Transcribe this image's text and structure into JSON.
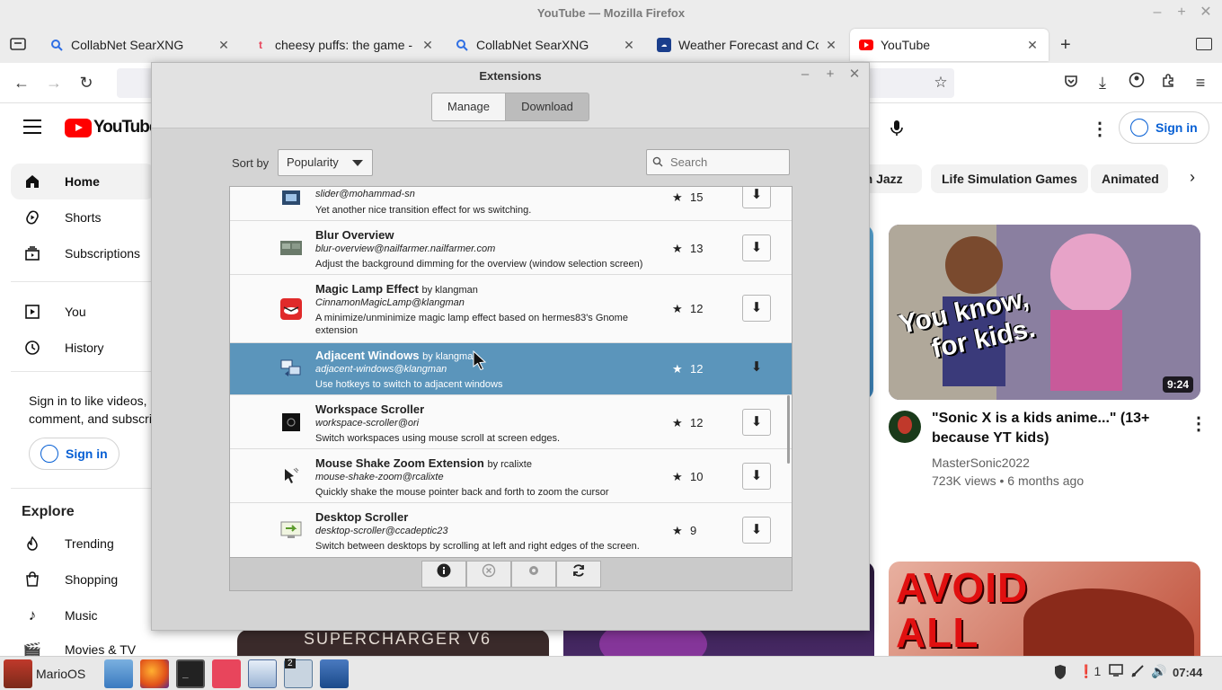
{
  "window": {
    "title": "YouTube — Mozilla Firefox"
  },
  "tabs": [
    {
      "label": "CollabNet SearXNG",
      "icon": "search-icon",
      "color": "#2f6fe4"
    },
    {
      "label": "cheesy puffs: the game - Tur",
      "icon": "tumblr-icon",
      "color": "#e8455c"
    },
    {
      "label": "CollabNet SearXNG",
      "icon": "search-icon",
      "color": "#2f6fe4"
    },
    {
      "label": "Weather Forecast and Condi",
      "icon": "weather-icon",
      "color": "#1a3e8c"
    },
    {
      "label": "YouTube",
      "icon": "youtube-icon",
      "color": "#ff0000",
      "active": true
    }
  ],
  "youtube": {
    "logo": "YouTube",
    "nav": [
      {
        "label": "Home",
        "icon": "home-icon"
      },
      {
        "label": "Shorts",
        "icon": "shorts-icon"
      },
      {
        "label": "Subscriptions",
        "icon": "subscriptions-icon"
      },
      {
        "label": "You",
        "icon": "you-icon"
      },
      {
        "label": "History",
        "icon": "history-icon"
      }
    ],
    "signin_prompt_line1": "Sign in to like videos,",
    "signin_prompt_line2": "comment, and subscribe.",
    "signin_label": "Sign in",
    "explore_title": "Explore",
    "explore": [
      {
        "label": "Trending",
        "icon": "trending-icon"
      },
      {
        "label": "Shopping",
        "icon": "shopping-icon"
      },
      {
        "label": "Music",
        "icon": "music-icon"
      },
      {
        "label": "Movies & TV",
        "icon": "movies-icon"
      }
    ],
    "chips": [
      "th Jazz",
      "Life Simulation Games",
      "Animated"
    ],
    "video": {
      "thumb_text_line1": "You know,",
      "thumb_text_line2": "for kids.",
      "duration": "9:24",
      "title": "\"Sonic X is a kids anime...\" (13+ because YT kids)",
      "channel": "MasterSonic2022",
      "stats": "723K views • 6 months ago"
    },
    "thumb2_text_line1": "AVOID",
    "thumb2_text_line2": "ALL",
    "thumb3_text": "SUPERCHARGER V6"
  },
  "extensions": {
    "title": "Extensions",
    "tabs": {
      "manage": "Manage",
      "download": "Download"
    },
    "sort_label": "Sort by",
    "sort_value": "Popularity",
    "search_placeholder": "Search",
    "items": [
      {
        "name": "",
        "by": "",
        "uuid": "slider@mohammad-sn",
        "desc": "Yet another nice transition effect for ws switching.",
        "score": "15",
        "icon": "slider-icon"
      },
      {
        "name": "Blur Overview",
        "by": "",
        "uuid": "blur-overview@nailfarmer.nailfarmer.com",
        "desc": "Adjust the background dimming for the overview (window selection screen)",
        "score": "13",
        "icon": "blur-overview-icon"
      },
      {
        "name": "Magic Lamp Effect",
        "by": "by klangman",
        "uuid": "CinnamonMagicLamp@klangman",
        "desc": "A minimize/unminimize magic lamp effect based on hermes83's Gnome extension",
        "score": "12",
        "icon": "magic-lamp-icon"
      },
      {
        "name": "Adjacent Windows",
        "by": "by klangman",
        "uuid": "adjacent-windows@klangman",
        "desc": "Use hotkeys to switch to adjacent windows",
        "score": "12",
        "icon": "adjacent-windows-icon",
        "selected": true
      },
      {
        "name": "Workspace Scroller",
        "by": "",
        "uuid": "workspace-scroller@ori",
        "desc": "Switch workspaces using mouse scroll at screen edges.",
        "score": "12",
        "icon": "workspace-scroller-icon"
      },
      {
        "name": "Mouse Shake Zoom Extension",
        "by": "by rcalixte",
        "uuid": "mouse-shake-zoom@rcalixte",
        "desc": "Quickly shake the mouse pointer back and forth to zoom the cursor",
        "score": "10",
        "icon": "mouse-shake-icon"
      },
      {
        "name": "Desktop Scroller",
        "by": "",
        "uuid": "desktop-scroller@ccadeptic23",
        "desc": "Switch between desktops by scrolling at left and right edges of the screen.",
        "score": "9",
        "icon": "desktop-scroller-icon"
      }
    ]
  },
  "taskbar": {
    "menu_label": "MarioOS",
    "workspace_badge": "2",
    "clock": "07:44",
    "notification_count": "1"
  }
}
